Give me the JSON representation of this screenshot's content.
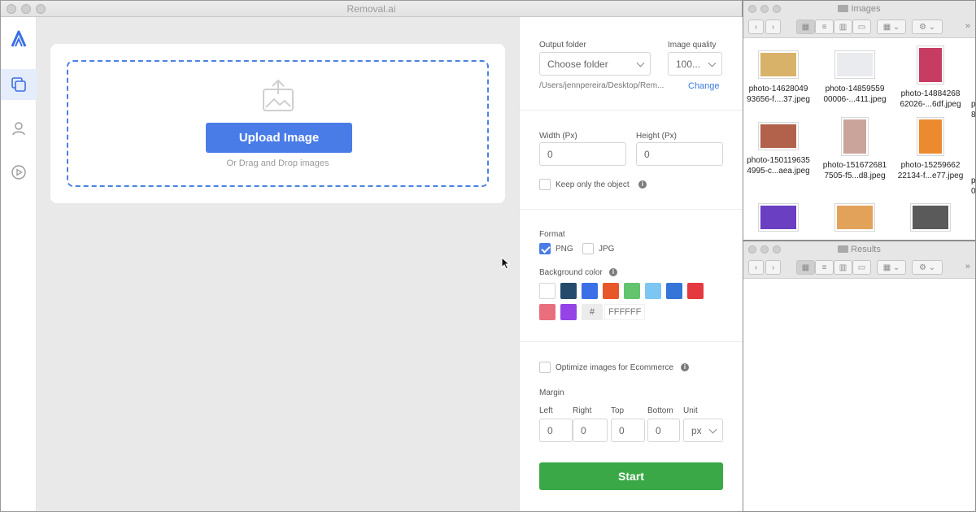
{
  "app": {
    "title": "Removal.ai"
  },
  "upload": {
    "button_label": "Upload Image",
    "hint": "Or Drag and Drop images"
  },
  "settings": {
    "output_folder_label": "Output folder",
    "output_folder_value": "Choose folder",
    "image_quality_label": "Image quality",
    "image_quality_value": "100...",
    "path": "/Users/jennpereira/Desktop/Rem...",
    "change_label": "Change",
    "width_label": "Width (Px)",
    "width_value": "0",
    "height_label": "Height (Px)",
    "height_value": "0",
    "keep_object_label": "Keep only the object",
    "format_label": "Format",
    "png_label": "PNG",
    "jpg_label": "JPG",
    "bg_color_label": "Background color",
    "hex_prefix": "#",
    "hex_value": "FFFFFF",
    "swatches": [
      "#ffffff",
      "#244b6c",
      "#3b6fe7",
      "#e8572a",
      "#63c46d",
      "#7dc6f3",
      "#3575d8",
      "#e53940",
      "#ea6f7e",
      "#9343e6"
    ],
    "optimize_label": "Optimize images for Ecommerce",
    "margin_label": "Margin",
    "left_label": "Left",
    "right_label": "Right",
    "top_label": "Top",
    "bottom_label": "Bottom",
    "unit_label": "Unit",
    "left_value": "0",
    "right_value": "0",
    "top_value": "0",
    "bottom_value": "0",
    "unit_value": "px",
    "start_label": "Start"
  },
  "finder_images": {
    "title": "Images",
    "files": [
      {
        "name_line1": "photo-14628049",
        "name_line2": "93656-f....37.jpeg",
        "color": "#d9b26a",
        "shape": "wide"
      },
      {
        "name_line1": "photo-14859559",
        "name_line2": "00006-...411.jpeg",
        "color": "#e9ebee",
        "shape": "wide"
      },
      {
        "name_line1": "photo-14884268",
        "name_line2": "62026-...6df.jpeg",
        "color": "#c73c63",
        "shape": "tall"
      },
      {
        "name_line1": "photo-150119635",
        "name_line2": "4995-c...aea.jpeg",
        "color": "#b2624a",
        "shape": "wide"
      },
      {
        "name_line1": "photo-151672681",
        "name_line2": "7505-f5...d8.jpeg",
        "color": "#caa49a",
        "shape": "tall"
      },
      {
        "name_line1": "photo-15259662",
        "name_line2": "22134-f...e77.jpeg",
        "color": "#ec8a2f",
        "shape": "tall"
      },
      {
        "name_line1": "",
        "name_line2": "",
        "color": "#6a3fc2",
        "shape": "wide"
      },
      {
        "name_line1": "",
        "name_line2": "",
        "color": "#e3a25a",
        "shape": "wide"
      },
      {
        "name_line1": "",
        "name_line2": "",
        "color": "#5a5a5a",
        "shape": "wide"
      }
    ],
    "partial_col": {
      "line1": "p",
      "line2": "8",
      "line3": "p",
      "line4": "0"
    }
  },
  "finder_results": {
    "title": "Results"
  },
  "toolbar": {
    "back": "‹",
    "forward": "›",
    "more": "»"
  }
}
